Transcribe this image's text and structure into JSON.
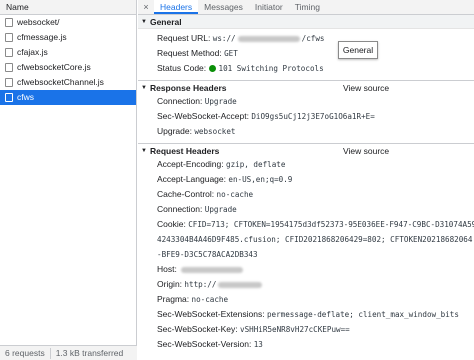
{
  "left_panel": {
    "header": "Name",
    "files": [
      {
        "name": "websocket/"
      },
      {
        "name": "cfmessage.js"
      },
      {
        "name": "cfajax.js"
      },
      {
        "name": "cfwebsocketCore.js"
      },
      {
        "name": "cfwebsocketChannel.js"
      },
      {
        "name": "cfws"
      }
    ],
    "footer": {
      "requests": "6 requests",
      "transferred": "1.3 kB transferred"
    }
  },
  "tabs": {
    "close": "×",
    "items": [
      "Headers",
      "Messages",
      "Initiator",
      "Timing"
    ]
  },
  "general": {
    "title": "General",
    "request_url_label": "Request URL:",
    "request_url_prefix": "ws://",
    "request_url_suffix": "/cfws",
    "request_method_label": "Request Method:",
    "request_method": "GET",
    "status_code_label": "Status Code:",
    "status_code": "101 Switching Protocols",
    "tooltip": "General"
  },
  "response_headers": {
    "title": "Response Headers",
    "view_source": "View source",
    "rows": [
      {
        "k": "Connection:",
        "v": "Upgrade"
      },
      {
        "k": "Sec-WebSocket-Accept:",
        "v": "DiO9gs5uCj12j3E7oG1O6a1R+E="
      },
      {
        "k": "Upgrade:",
        "v": "websocket"
      }
    ]
  },
  "request_headers": {
    "title": "Request Headers",
    "view_source": "View source",
    "accept_encoding": {
      "k": "Accept-Encoding:",
      "v": "gzip, deflate"
    },
    "accept_language": {
      "k": "Accept-Language:",
      "v": "en-US,en;q=0.9"
    },
    "cache_control": {
      "k": "Cache-Control:",
      "v": "no-cache"
    },
    "connection": {
      "k": "Connection:",
      "v": "Upgrade"
    },
    "cookie": {
      "k": "Cookie:",
      "line1": "CFID=713; CFTOKEN=1954175d3df52373-95E036EE-F947-C9BC-D31074A59",
      "line2": "4243304B4A46D9F485.cfusion; CFID2021868206429=802; CFTOKEN20218682064",
      "line3": "-BFE9-D3C5C78ACA2DB343"
    },
    "host": {
      "k": "Host:"
    },
    "origin": {
      "k": "Origin:",
      "v": "http://"
    },
    "pragma": {
      "k": "Pragma:",
      "v": "no-cache"
    },
    "extensions": {
      "k": "Sec-WebSocket-Extensions:",
      "v": "permessage-deflate; client_max_window_bits"
    },
    "key": {
      "k": "Sec-WebSocket-Key:",
      "v": "vSHHiR5eNR8vH27cCKEPuw=="
    },
    "version": {
      "k": "Sec-WebSocket-Version:",
      "v": "13"
    }
  },
  "colors": {
    "accent": "#1a73e8",
    "status_green": "#0a8f08"
  }
}
